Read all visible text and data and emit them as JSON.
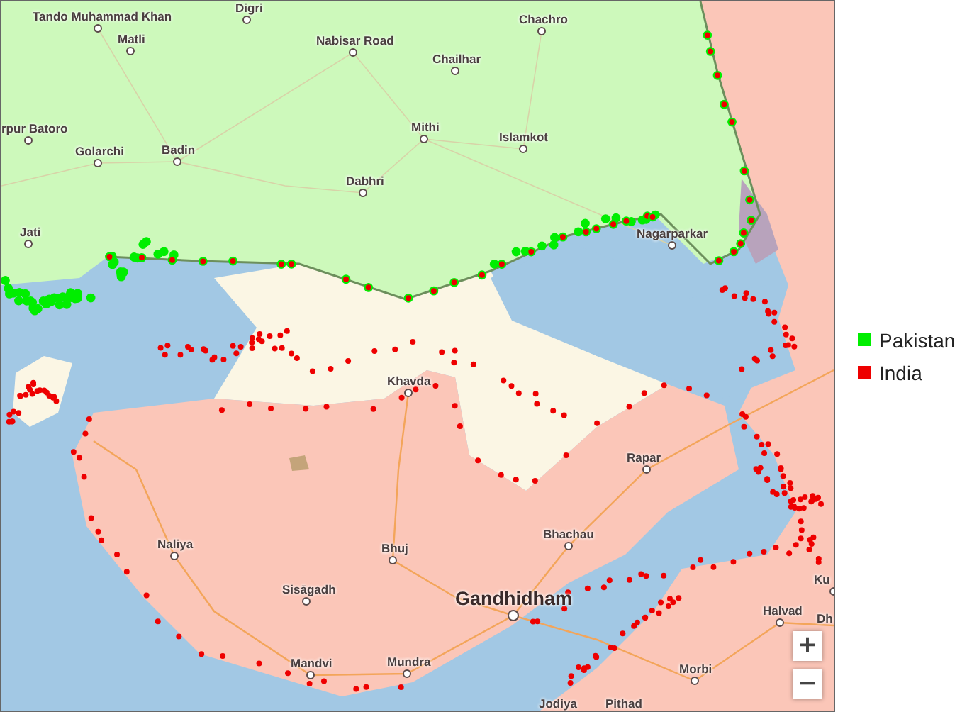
{
  "map": {
    "places": [
      {
        "name": "Tando Muhammad Khan",
        "kind": "town"
      },
      {
        "name": "Matli",
        "kind": "town"
      },
      {
        "name": "Digri",
        "kind": "town"
      },
      {
        "name": "Nabisar Road",
        "kind": "town"
      },
      {
        "name": "Chailhar",
        "kind": "town"
      },
      {
        "name": "Chachro",
        "kind": "town"
      },
      {
        "name": "rpur Batoro",
        "kind": "town"
      },
      {
        "name": "Golarchi",
        "kind": "town"
      },
      {
        "name": "Badin",
        "kind": "town"
      },
      {
        "name": "Mithi",
        "kind": "town"
      },
      {
        "name": "Islamkot",
        "kind": "town"
      },
      {
        "name": "Dabhri",
        "kind": "town"
      },
      {
        "name": "Jati",
        "kind": "town"
      },
      {
        "name": "Nagarparkar",
        "kind": "town"
      },
      {
        "name": "Khavda",
        "kind": "town"
      },
      {
        "name": "Rapar",
        "kind": "town"
      },
      {
        "name": "Bhachau",
        "kind": "town"
      },
      {
        "name": "Naliya",
        "kind": "town"
      },
      {
        "name": "Bhuj",
        "kind": "town"
      },
      {
        "name": "Sisāgadh",
        "kind": "town"
      },
      {
        "name": "Gandhidham",
        "kind": "city"
      },
      {
        "name": "Ku",
        "kind": "town"
      },
      {
        "name": "Halvad",
        "kind": "town"
      },
      {
        "name": "Dh",
        "kind": "town"
      },
      {
        "name": "Mandvi",
        "kind": "town"
      },
      {
        "name": "Mundra",
        "kind": "town"
      },
      {
        "name": "Morbi",
        "kind": "town"
      },
      {
        "name": "Jodiya",
        "kind": "town"
      },
      {
        "name": "Pithad",
        "kind": "town"
      }
    ],
    "zoom_controls": [
      "+",
      "−"
    ]
  },
  "legend": [
    {
      "label": "Pakistan",
      "color": "#00ee00"
    },
    {
      "label": "India",
      "color": "#ee0000"
    }
  ]
}
